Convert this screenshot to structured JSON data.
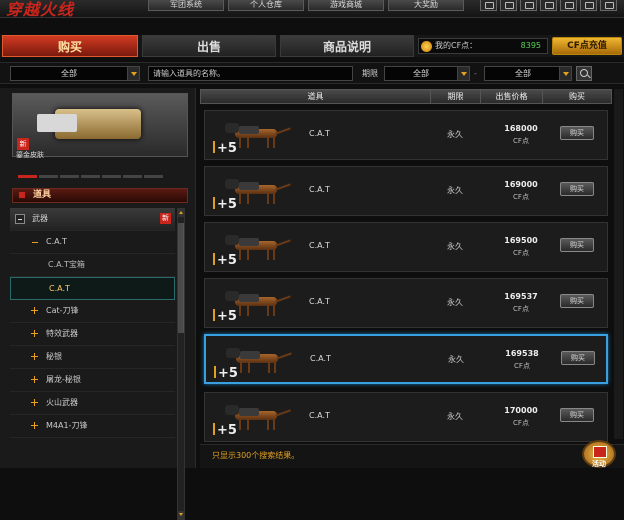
{
  "header": {
    "logo": "穿越火线",
    "nav": [
      "军团系统",
      "个人仓库",
      "游戏商城",
      "大奖励"
    ]
  },
  "tabs": [
    "购买",
    "出售",
    "商品说明"
  ],
  "points": {
    "label": "我的CF点：",
    "value": "8395"
  },
  "cf_button": "CF点充值",
  "filter": {
    "category": "全部",
    "search_placeholder": "请输入道具的名称。",
    "period_label": "期限",
    "period_value": "全部",
    "sep": "-",
    "sort_value": "全部"
  },
  "preview": {
    "tag": "新",
    "caption": "鎏金皮肤"
  },
  "category_header": "道具",
  "tree": [
    {
      "label": "武器",
      "level": "l0",
      "tag": "新"
    },
    {
      "label": "C.A.T",
      "level": "l1"
    },
    {
      "label": "C.A.T宝箱",
      "level": "l2"
    },
    {
      "label": "C.A.T",
      "level": "l2",
      "selected": true
    },
    {
      "label": "Cat-刀锋",
      "level": "l1"
    },
    {
      "label": "特效武器",
      "level": "l1"
    },
    {
      "label": "秘银",
      "level": "l1"
    },
    {
      "label": "屠龙-秘银",
      "level": "l1"
    },
    {
      "label": "火山武器",
      "level": "l1"
    },
    {
      "label": "M4A1-刀锋",
      "level": "l1"
    }
  ],
  "table": {
    "headers": [
      "道具",
      "期限",
      "出售价格",
      "购买"
    ]
  },
  "products": [
    {
      "name": "C.A.T",
      "duration": "永久",
      "price": "168000",
      "currency": "CF点",
      "buy": "购买",
      "plus": "+5"
    },
    {
      "name": "C.A.T",
      "duration": "永久",
      "price": "169000",
      "currency": "CF点",
      "buy": "购买",
      "plus": "+5"
    },
    {
      "name": "C.A.T",
      "duration": "永久",
      "price": "169500",
      "currency": "CF点",
      "buy": "购买",
      "plus": "+5"
    },
    {
      "name": "C.A.T",
      "duration": "永久",
      "price": "169537",
      "currency": "CF点",
      "buy": "购买",
      "plus": "+5"
    },
    {
      "name": "C.A.T",
      "duration": "永久",
      "price": "169538",
      "currency": "CF点",
      "buy": "购买",
      "plus": "+5"
    },
    {
      "name": "C.A.T",
      "duration": "永久",
      "price": "170000",
      "currency": "CF点",
      "buy": "购买",
      "plus": "+5"
    }
  ],
  "footer_note": "只显示300个搜索结果。",
  "gift_label": "活动"
}
